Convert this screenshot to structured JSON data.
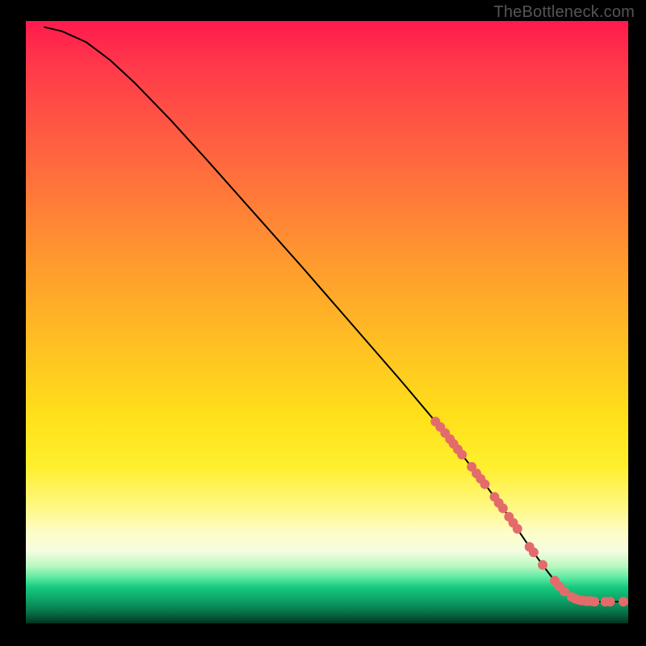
{
  "watermark": "TheBottleneck.com",
  "chart_data": {
    "type": "line",
    "title": "",
    "xlabel": "",
    "ylabel": "",
    "xlim": [
      0,
      100
    ],
    "ylim": [
      0,
      100
    ],
    "grid": false,
    "legend": false,
    "curve": [
      {
        "x": 3,
        "y": 99
      },
      {
        "x": 6,
        "y": 98.3
      },
      {
        "x": 10,
        "y": 96.5
      },
      {
        "x": 14,
        "y": 93.5
      },
      {
        "x": 18,
        "y": 89.8
      },
      {
        "x": 24,
        "y": 83.6
      },
      {
        "x": 30,
        "y": 77.0
      },
      {
        "x": 38,
        "y": 68.0
      },
      {
        "x": 46,
        "y": 59.0
      },
      {
        "x": 54,
        "y": 49.8
      },
      {
        "x": 62,
        "y": 40.6
      },
      {
        "x": 68,
        "y": 33.5
      },
      {
        "x": 72,
        "y": 28.5
      },
      {
        "x": 76,
        "y": 23.4
      },
      {
        "x": 80,
        "y": 18.0
      },
      {
        "x": 83,
        "y": 13.6
      },
      {
        "x": 86,
        "y": 9.4
      },
      {
        "x": 88,
        "y": 6.8
      },
      {
        "x": 90,
        "y": 4.9
      },
      {
        "x": 91.5,
        "y": 4.0
      },
      {
        "x": 93,
        "y": 3.7
      },
      {
        "x": 95,
        "y": 3.6
      },
      {
        "x": 97,
        "y": 3.6
      },
      {
        "x": 99,
        "y": 3.6
      }
    ],
    "highlight_points": [
      {
        "x": 68.0,
        "y": 33.5
      },
      {
        "x": 68.8,
        "y": 32.6
      },
      {
        "x": 69.6,
        "y": 31.6
      },
      {
        "x": 70.4,
        "y": 30.6
      },
      {
        "x": 71.0,
        "y": 29.8
      },
      {
        "x": 71.7,
        "y": 28.9
      },
      {
        "x": 72.4,
        "y": 28.0
      },
      {
        "x": 74.0,
        "y": 26.0
      },
      {
        "x": 74.8,
        "y": 24.9
      },
      {
        "x": 75.5,
        "y": 24.0
      },
      {
        "x": 76.2,
        "y": 23.1
      },
      {
        "x": 77.8,
        "y": 21.0
      },
      {
        "x": 78.5,
        "y": 20.0
      },
      {
        "x": 79.2,
        "y": 19.1
      },
      {
        "x": 80.2,
        "y": 17.7
      },
      {
        "x": 80.9,
        "y": 16.7
      },
      {
        "x": 81.6,
        "y": 15.7
      },
      {
        "x": 83.6,
        "y": 12.7
      },
      {
        "x": 84.3,
        "y": 11.8
      },
      {
        "x": 85.8,
        "y": 9.7
      },
      {
        "x": 87.8,
        "y": 7.1
      },
      {
        "x": 88.5,
        "y": 6.2
      },
      {
        "x": 89.4,
        "y": 5.3
      },
      {
        "x": 90.6,
        "y": 4.4
      },
      {
        "x": 91.2,
        "y": 4.1
      },
      {
        "x": 91.8,
        "y": 3.9
      },
      {
        "x": 92.4,
        "y": 3.8
      },
      {
        "x": 93.1,
        "y": 3.7
      },
      {
        "x": 93.8,
        "y": 3.7
      },
      {
        "x": 94.4,
        "y": 3.6
      },
      {
        "x": 96.2,
        "y": 3.6
      },
      {
        "x": 97.0,
        "y": 3.6
      },
      {
        "x": 99.2,
        "y": 3.6
      }
    ],
    "colors": {
      "curve": "#000000",
      "highlight": "#e46b6b"
    }
  }
}
